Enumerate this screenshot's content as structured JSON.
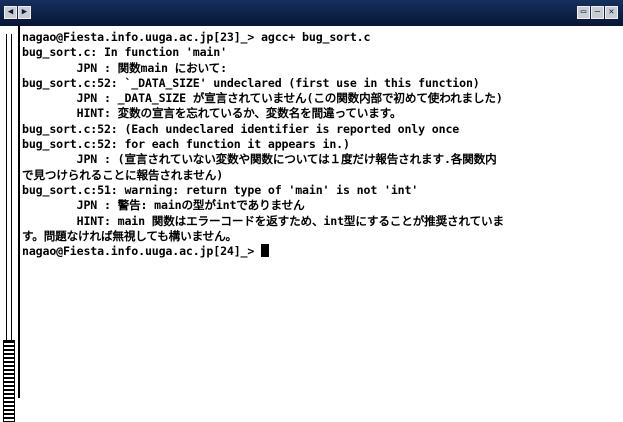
{
  "window": {
    "title": "",
    "buttons": {
      "left_a": "◀",
      "left_b": "▶",
      "minimize": "▭",
      "maximize": "—",
      "close": "✕"
    }
  },
  "terminal": {
    "lines": [
      "nagao@Fiesta.info.uuga.ac.jp[23]_> agcc+ bug_sort.c",
      "bug_sort.c: In function 'main'",
      "        JPN : 関数main において:",
      "bug_sort.c:52: `_DATA_SIZE' undeclared (first use in this function)",
      "        JPN : _DATA_SIZE が宣言されていません(この関数内部で初めて使われました)",
      "        HINT: 変数の宣言を忘れているか、変数名を間違っています。",
      "bug_sort.c:52: (Each undeclared identifier is reported only once",
      "bug_sort.c:52: for each function it appears in.)",
      "        JPN : (宣言されていない変数や関数については１度だけ報告されます.各関数内",
      "で見つけられることに報告されません)",
      "bug_sort.c:51: warning: return type of 'main' is not 'int'",
      "        JPN : 警告: mainの型がintでありません",
      "        HINT: main 関数はエラーコードを返すため、int型にすることが推奨されていま",
      "す。問題なければ無視しても構いません。"
    ],
    "prompt": "nagao@Fiesta.info.uuga.ac.jp[24]_> "
  }
}
